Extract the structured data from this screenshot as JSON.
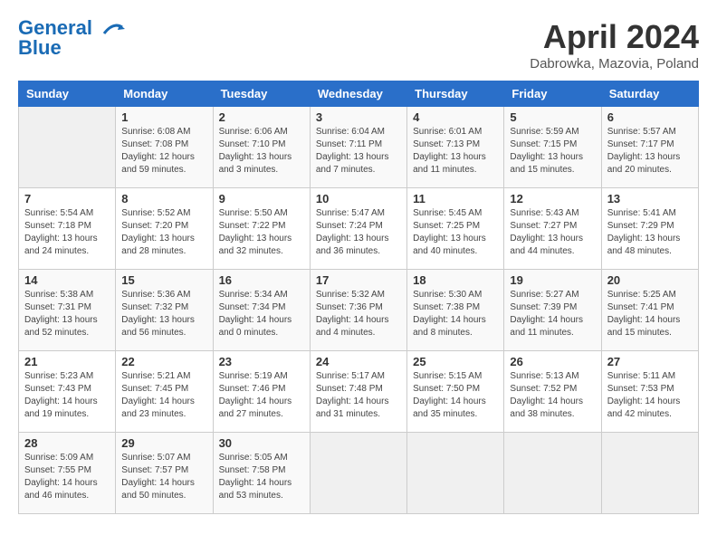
{
  "header": {
    "logo_line1": "General",
    "logo_line2": "Blue",
    "title": "April 2024",
    "location": "Dabrowka, Mazovia, Poland"
  },
  "days_of_week": [
    "Sunday",
    "Monday",
    "Tuesday",
    "Wednesday",
    "Thursday",
    "Friday",
    "Saturday"
  ],
  "weeks": [
    [
      {
        "day": "",
        "info": ""
      },
      {
        "day": "1",
        "info": "Sunrise: 6:08 AM\nSunset: 7:08 PM\nDaylight: 12 hours\nand 59 minutes."
      },
      {
        "day": "2",
        "info": "Sunrise: 6:06 AM\nSunset: 7:10 PM\nDaylight: 13 hours\nand 3 minutes."
      },
      {
        "day": "3",
        "info": "Sunrise: 6:04 AM\nSunset: 7:11 PM\nDaylight: 13 hours\nand 7 minutes."
      },
      {
        "day": "4",
        "info": "Sunrise: 6:01 AM\nSunset: 7:13 PM\nDaylight: 13 hours\nand 11 minutes."
      },
      {
        "day": "5",
        "info": "Sunrise: 5:59 AM\nSunset: 7:15 PM\nDaylight: 13 hours\nand 15 minutes."
      },
      {
        "day": "6",
        "info": "Sunrise: 5:57 AM\nSunset: 7:17 PM\nDaylight: 13 hours\nand 20 minutes."
      }
    ],
    [
      {
        "day": "7",
        "info": "Sunrise: 5:54 AM\nSunset: 7:18 PM\nDaylight: 13 hours\nand 24 minutes."
      },
      {
        "day": "8",
        "info": "Sunrise: 5:52 AM\nSunset: 7:20 PM\nDaylight: 13 hours\nand 28 minutes."
      },
      {
        "day": "9",
        "info": "Sunrise: 5:50 AM\nSunset: 7:22 PM\nDaylight: 13 hours\nand 32 minutes."
      },
      {
        "day": "10",
        "info": "Sunrise: 5:47 AM\nSunset: 7:24 PM\nDaylight: 13 hours\nand 36 minutes."
      },
      {
        "day": "11",
        "info": "Sunrise: 5:45 AM\nSunset: 7:25 PM\nDaylight: 13 hours\nand 40 minutes."
      },
      {
        "day": "12",
        "info": "Sunrise: 5:43 AM\nSunset: 7:27 PM\nDaylight: 13 hours\nand 44 minutes."
      },
      {
        "day": "13",
        "info": "Sunrise: 5:41 AM\nSunset: 7:29 PM\nDaylight: 13 hours\nand 48 minutes."
      }
    ],
    [
      {
        "day": "14",
        "info": "Sunrise: 5:38 AM\nSunset: 7:31 PM\nDaylight: 13 hours\nand 52 minutes."
      },
      {
        "day": "15",
        "info": "Sunrise: 5:36 AM\nSunset: 7:32 PM\nDaylight: 13 hours\nand 56 minutes."
      },
      {
        "day": "16",
        "info": "Sunrise: 5:34 AM\nSunset: 7:34 PM\nDaylight: 14 hours\nand 0 minutes."
      },
      {
        "day": "17",
        "info": "Sunrise: 5:32 AM\nSunset: 7:36 PM\nDaylight: 14 hours\nand 4 minutes."
      },
      {
        "day": "18",
        "info": "Sunrise: 5:30 AM\nSunset: 7:38 PM\nDaylight: 14 hours\nand 8 minutes."
      },
      {
        "day": "19",
        "info": "Sunrise: 5:27 AM\nSunset: 7:39 PM\nDaylight: 14 hours\nand 11 minutes."
      },
      {
        "day": "20",
        "info": "Sunrise: 5:25 AM\nSunset: 7:41 PM\nDaylight: 14 hours\nand 15 minutes."
      }
    ],
    [
      {
        "day": "21",
        "info": "Sunrise: 5:23 AM\nSunset: 7:43 PM\nDaylight: 14 hours\nand 19 minutes."
      },
      {
        "day": "22",
        "info": "Sunrise: 5:21 AM\nSunset: 7:45 PM\nDaylight: 14 hours\nand 23 minutes."
      },
      {
        "day": "23",
        "info": "Sunrise: 5:19 AM\nSunset: 7:46 PM\nDaylight: 14 hours\nand 27 minutes."
      },
      {
        "day": "24",
        "info": "Sunrise: 5:17 AM\nSunset: 7:48 PM\nDaylight: 14 hours\nand 31 minutes."
      },
      {
        "day": "25",
        "info": "Sunrise: 5:15 AM\nSunset: 7:50 PM\nDaylight: 14 hours\nand 35 minutes."
      },
      {
        "day": "26",
        "info": "Sunrise: 5:13 AM\nSunset: 7:52 PM\nDaylight: 14 hours\nand 38 minutes."
      },
      {
        "day": "27",
        "info": "Sunrise: 5:11 AM\nSunset: 7:53 PM\nDaylight: 14 hours\nand 42 minutes."
      }
    ],
    [
      {
        "day": "28",
        "info": "Sunrise: 5:09 AM\nSunset: 7:55 PM\nDaylight: 14 hours\nand 46 minutes."
      },
      {
        "day": "29",
        "info": "Sunrise: 5:07 AM\nSunset: 7:57 PM\nDaylight: 14 hours\nand 50 minutes."
      },
      {
        "day": "30",
        "info": "Sunrise: 5:05 AM\nSunset: 7:58 PM\nDaylight: 14 hours\nand 53 minutes."
      },
      {
        "day": "",
        "info": ""
      },
      {
        "day": "",
        "info": ""
      },
      {
        "day": "",
        "info": ""
      },
      {
        "day": "",
        "info": ""
      }
    ]
  ]
}
